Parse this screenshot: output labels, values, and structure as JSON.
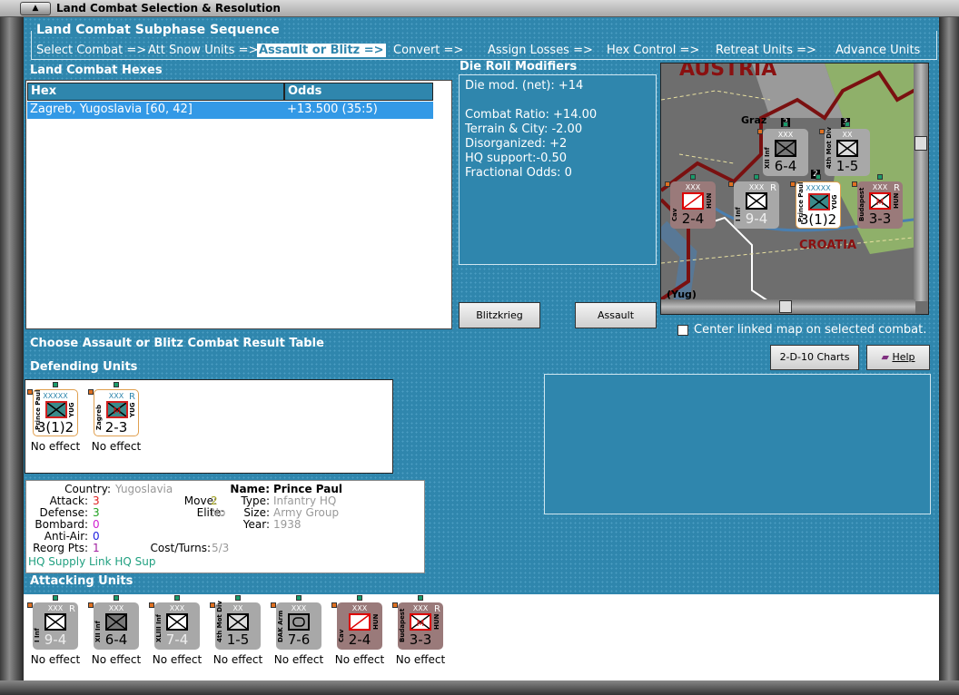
{
  "window": {
    "title": "Land Combat Selection & Resolution"
  },
  "sequence": {
    "title": "Land Combat Subphase Sequence",
    "steps": [
      "Select Combat =>",
      "Att Snow Units =>",
      "Assault or Blitz =>",
      "Convert =>",
      "Assign Losses =>",
      "Hex Control =>",
      "Retreat Units =>",
      "Advance Units"
    ],
    "active": 2
  },
  "hexes": {
    "title": "Land Combat Hexes",
    "columns": [
      "Hex",
      "Odds"
    ],
    "rows": [
      {
        "hex": "Zagreb, Yugoslavia [60, 42]",
        "odds": "+13.500 (35:5)"
      }
    ]
  },
  "die": {
    "title": "Die Roll Modifiers",
    "lines": [
      "Die mod. (net): +14",
      "",
      "Combat Ratio: +14.00",
      "Terrain & City: -2.00",
      "Disorganized: +2",
      "HQ support:-0.50",
      "Fractional Odds: 0"
    ]
  },
  "buttons": {
    "blitz": "Blitzkrieg",
    "assault": "Assault",
    "charts": "2-D-10 Charts",
    "help": "Help"
  },
  "center_checkbox": {
    "label": "Center linked map on selected combat.",
    "checked": false
  },
  "crt_title": "Choose Assault or Blitz Combat Result Table",
  "map": {
    "labels": [
      "AUSTRIA",
      "Graz",
      "CROATIA",
      "(Yug)"
    ],
    "stack_counts": [
      "2",
      "3",
      "2"
    ]
  },
  "defending": {
    "title": "Defending Units",
    "units": [
      {
        "name": "Prince Paul",
        "size": "XXXXX",
        "nat": "YUG",
        "strength": "3(1)2",
        "type": "inf",
        "color": "#ffffff",
        "sym": "#3a8a8a",
        "effect": "No effect",
        "r": ""
      },
      {
        "name": "Zagreb",
        "size": "XXX",
        "nat": "YUG",
        "strength": "2-3",
        "type": "mil",
        "color": "#ffffff",
        "sym": "#3a8a8a",
        "effect": "No effect",
        "r": "R"
      }
    ]
  },
  "info": {
    "country_label": "Country:",
    "country": "Yugoslavia",
    "attack_label": "Attack:",
    "attack": "3",
    "defense_label": "Defense:",
    "defense": "3",
    "bombard_label": "Bombard:",
    "bombard": "0",
    "antiair_label": "Anti-Air:",
    "antiair": "0",
    "reorg_label": "Reorg Pts:",
    "reorg": "1",
    "move_label": "Move:",
    "move": "2",
    "elite_label": "Elite:",
    "elite": "No",
    "cost_label": "Cost/Turns:",
    "cost": "5/3",
    "name_label": "Name:",
    "name": "Prince Paul",
    "type_label": "Type:",
    "type": "Infantry HQ",
    "size_label": "Size:",
    "size": "Army Group",
    "year_label": "Year:",
    "year": "1938",
    "supply": "HQ Supply Link HQ Sup"
  },
  "attacking": {
    "title": "Attacking Units",
    "units": [
      {
        "name": "I Inf",
        "size": "XXX",
        "nat": "",
        "strength": "9-4",
        "type": "inf",
        "color": "#a8a8a8",
        "sym": "#ffffff",
        "effect": "No effect",
        "r": "R"
      },
      {
        "name": "XII Inf",
        "size": "XXX",
        "nat": "",
        "strength": "6-4",
        "type": "inf",
        "color": "#a8a8a8",
        "sym": "#777777",
        "effect": "No effect",
        "r": ""
      },
      {
        "name": "XLIII Inf",
        "size": "XXX",
        "nat": "",
        "strength": "7-4",
        "type": "inf",
        "color": "#a8a8a8",
        "sym": "#ffffff",
        "effect": "No effect",
        "r": ""
      },
      {
        "name": "4th Mot Div",
        "size": "XX",
        "nat": "",
        "strength": "1-5",
        "type": "mot",
        "color": "#a8a8a8",
        "sym": "#dddddd",
        "effect": "No effect",
        "r": ""
      },
      {
        "name": "DAK Arm",
        "size": "XXX",
        "nat": "",
        "strength": "7-6",
        "type": "arm",
        "color": "#a8a8a8",
        "sym": "#999999",
        "effect": "No effect",
        "r": ""
      },
      {
        "name": "Cav",
        "size": "XXX",
        "nat": "HUN",
        "strength": "2-4",
        "type": "cav",
        "color": "#9a7a7a",
        "sym": "#ffffff",
        "effect": "No effect",
        "r": ""
      },
      {
        "name": "Budapest",
        "size": "XXX",
        "nat": "HUN",
        "strength": "3-3",
        "type": "mil",
        "color": "#9a7a7a",
        "sym": "#ffffff",
        "effect": "No effect",
        "r": "R"
      }
    ]
  }
}
